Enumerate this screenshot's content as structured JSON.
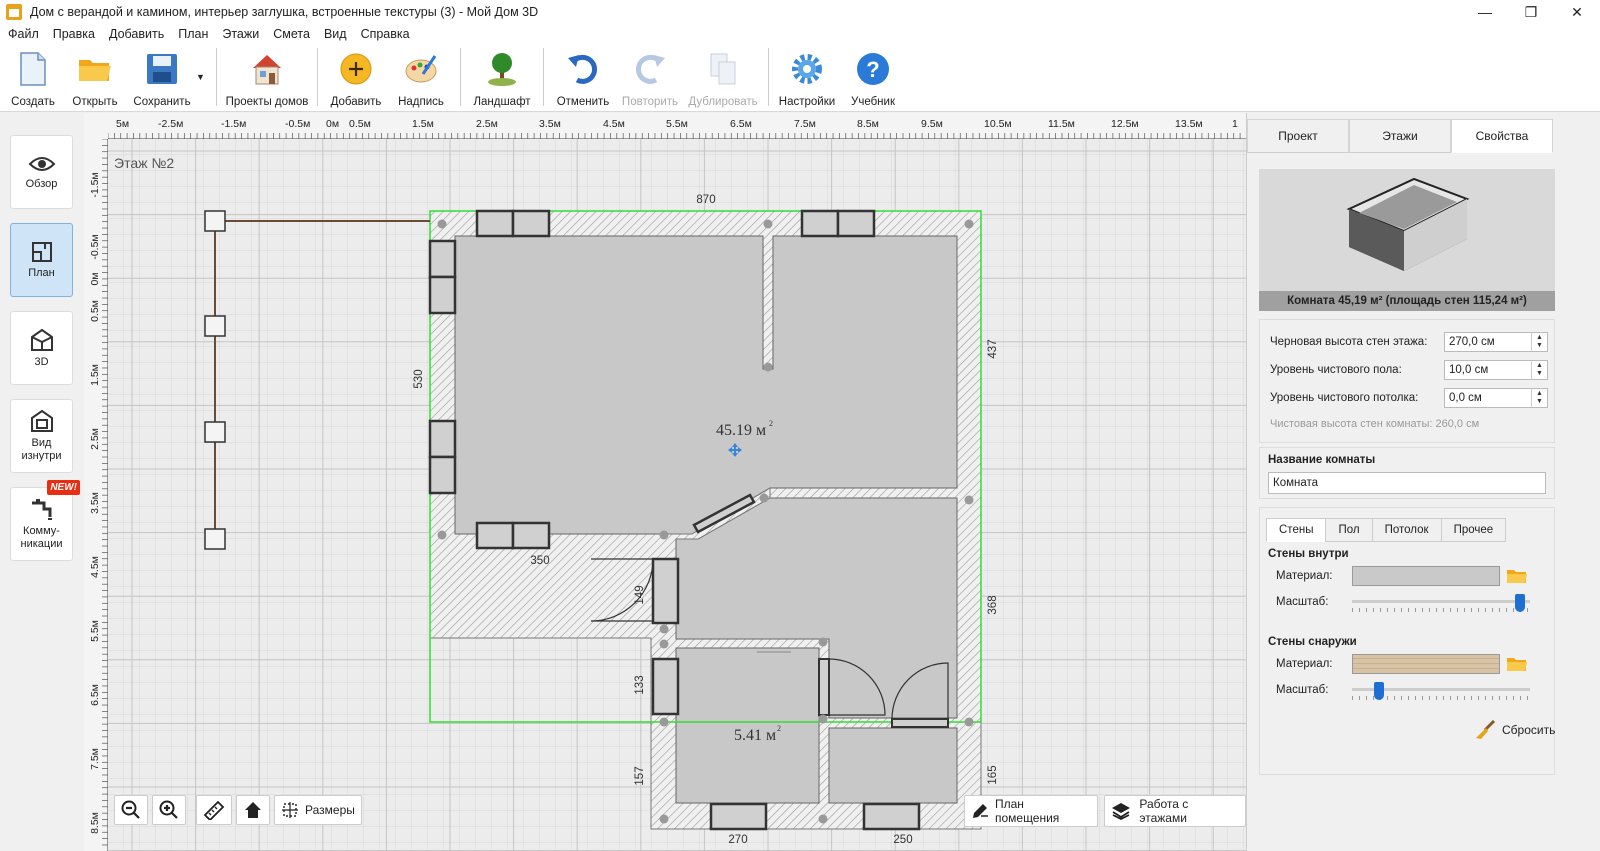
{
  "window": {
    "title": "Дом с верандой и камином, интерьер заглушка, встроенные текстуры (3) - Мой Дом 3D",
    "controls": [
      "—",
      "❐",
      "✕"
    ]
  },
  "menu": [
    "Файл",
    "Правка",
    "Добавить",
    "План",
    "Этажи",
    "Смета",
    "Вид",
    "Справка"
  ],
  "toolbar": {
    "create": "Создать",
    "open": "Открыть",
    "save": "Сохранить",
    "projects": "Проекты домов",
    "add": "Добавить",
    "label": "Надпись",
    "landscape": "Ландшафт",
    "undo": "Отменить",
    "redo": "Повторить",
    "duplicate": "Дублировать",
    "settings": "Настройки",
    "tutorial": "Учебник"
  },
  "leftbar": {
    "overview": "Обзор",
    "plan": "План",
    "view3d": "3D",
    "inside_l1": "Вид",
    "inside_l2": "изнутри",
    "comm_l1": "Комму-",
    "comm_l2": "никации",
    "new_badge": "NEW!"
  },
  "canvas": {
    "floor_label": "Этаж №2",
    "ruler_top": [
      "5м",
      "-2.5м",
      "-1.5м",
      "-0.5м",
      "0м",
      "0.5м",
      "1.5м",
      "2.5м",
      "3.5м",
      "4.5м",
      "5.5м",
      "6.5м",
      "7.5м",
      "8.5м",
      "9.5м",
      "10.5м",
      "11.5м",
      "12.5м",
      "13.5м",
      "1"
    ],
    "ruler_left": [
      "-1.5м",
      "-0.5м",
      "0м",
      "0.5м",
      "1.5м",
      "2.5м",
      "3.5м",
      "4.5м",
      "5.5м",
      "6.5м",
      "7.5м",
      "8.5м"
    ],
    "dimensions": {
      "top": "870",
      "left": "530",
      "right_upper": "437",
      "right_lower": "368",
      "right_bottom": "165",
      "inner_350": "350",
      "inner_149": "149",
      "inner_133": "133",
      "inner_157": "157",
      "bottom_270": "270",
      "bottom_250": "250"
    },
    "room_area_main": "45.19 м",
    "room_area_small": "5.41 м",
    "sup": "2"
  },
  "bottom_controls": {
    "sizes": "Размеры",
    "room_plan": "План помещения",
    "floors_work": "Работа с этажами"
  },
  "rightpanel": {
    "tabs": [
      "Проект",
      "Этажи",
      "Свойства"
    ],
    "active_tab": "Свойства",
    "preview_caption": "Комната 45,19 м²  (площадь стен 115,24 м²)",
    "rough_height_label": "Черновая высота стен этажа:",
    "rough_height_value": "270,0 см",
    "floor_level_label": "Уровень чистового пола:",
    "floor_level_value": "10,0 см",
    "ceiling_level_label": "Уровень чистового потолка:",
    "ceiling_level_value": "0,0 см",
    "clean_height_text": "Чистовая высота стен комнаты: 260,0 см",
    "room_name_title": "Название комнаты",
    "room_name_value": "Комната",
    "subtabs": [
      "Стены",
      "Пол",
      "Потолок",
      "Прочее"
    ],
    "walls_inside_title": "Стены внутри",
    "walls_outside_title": "Стены снаружи",
    "material_label": "Материал:",
    "scale_label": "Масштаб:",
    "inside_scale": 0.97,
    "outside_scale": 0.13,
    "reset": "Сбросить"
  },
  "colors": {
    "selection": "#33dd33",
    "wall_line": "#555555",
    "room_fill": "#c8c8c8",
    "fence": "#6b4a36",
    "accent": "#1d6fd1"
  }
}
